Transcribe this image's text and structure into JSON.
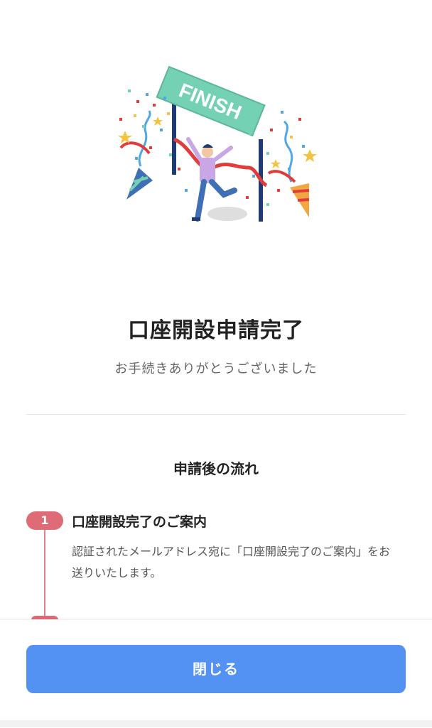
{
  "hero": {
    "sign_text": "FINISH",
    "colors": {
      "sign": "#74d1b4",
      "post": "#1f3b73",
      "shirt": "#c9a6e6",
      "pants": "#3f6fb5",
      "ribbon": "#e23b3b",
      "confetti_blue": "#4fa7e8",
      "confetti_red": "#e23b3b",
      "confetti_yellow": "#f5c342"
    }
  },
  "page": {
    "title": "口座開設申請完了",
    "subtitle": "お手続きありがとうございました"
  },
  "flow": {
    "heading": "申請後の流れ",
    "steps": [
      {
        "number": "1",
        "title": "口座開設完了のご案内",
        "description": "認証されたメールアドレス宛に「口座開設完了のご案内」をお送りいたします。"
      }
    ]
  },
  "footer": {
    "close_label": "閉じる"
  },
  "colors": {
    "accent_button": "#5392f2",
    "step_badge": "#df6b77"
  }
}
